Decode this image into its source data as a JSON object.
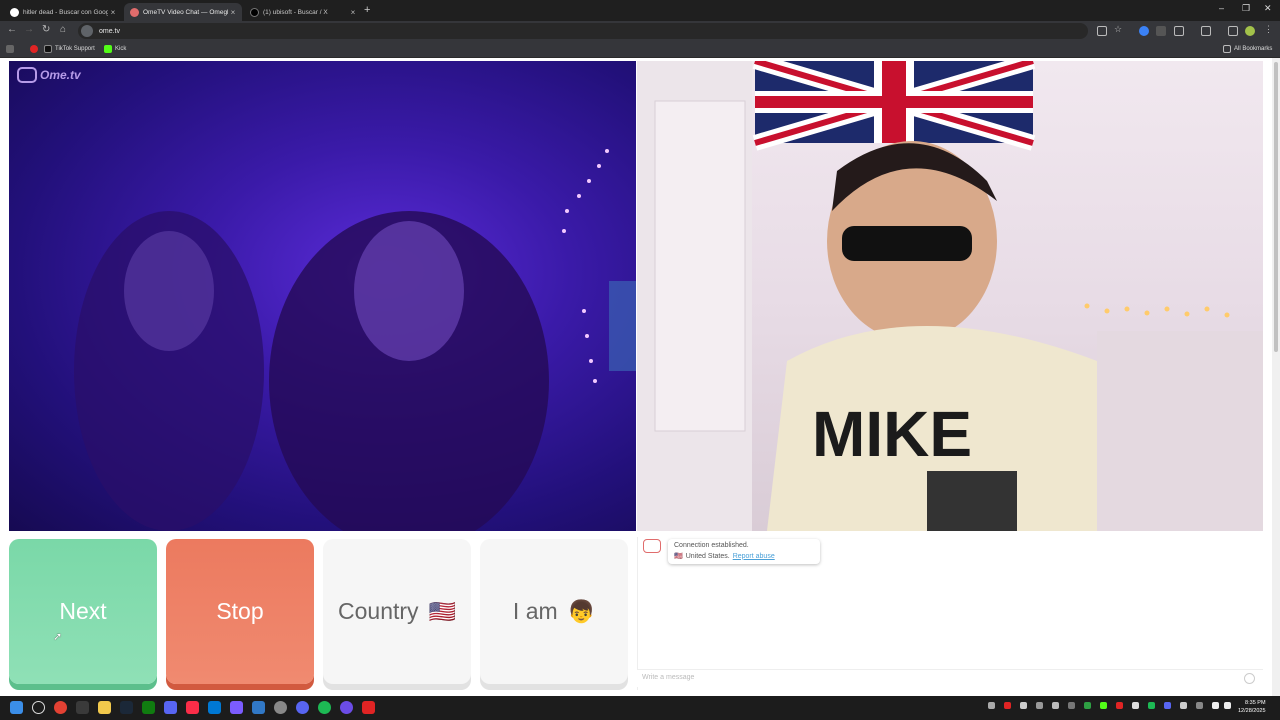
{
  "browser": {
    "tabs": [
      {
        "title": "hitler dead - Buscar con Google",
        "active": false
      },
      {
        "title": "OmeTV Video Chat — Omegle",
        "active": true
      },
      {
        "title": "(1) ubisoft - Buscar / X",
        "active": false
      }
    ],
    "url": "ome.tv",
    "bookmarks": [
      {
        "label": "TikTok Support"
      },
      {
        "label": "Kick"
      }
    ],
    "all_bookmarks": "All Bookmarks"
  },
  "page": {
    "logo_text": "Ome.tv",
    "buttons": {
      "next": "Next",
      "stop": "Stop",
      "country": "Country",
      "country_flag": "🇺🇸",
      "iam": "I am",
      "iam_emoji": "👦"
    },
    "chat": {
      "message_line1": "Connection established.",
      "message_flag": "🇺🇸",
      "message_country": "United States.",
      "message_report": "Report abuse",
      "input_placeholder": "Write a message"
    },
    "colors": {
      "next": "#7ad8a8",
      "stop": "#ec7a5f",
      "neutral": "#f6f6f6"
    }
  },
  "taskbar": {
    "time": "8:35 PM",
    "date": "12/28/2025"
  }
}
